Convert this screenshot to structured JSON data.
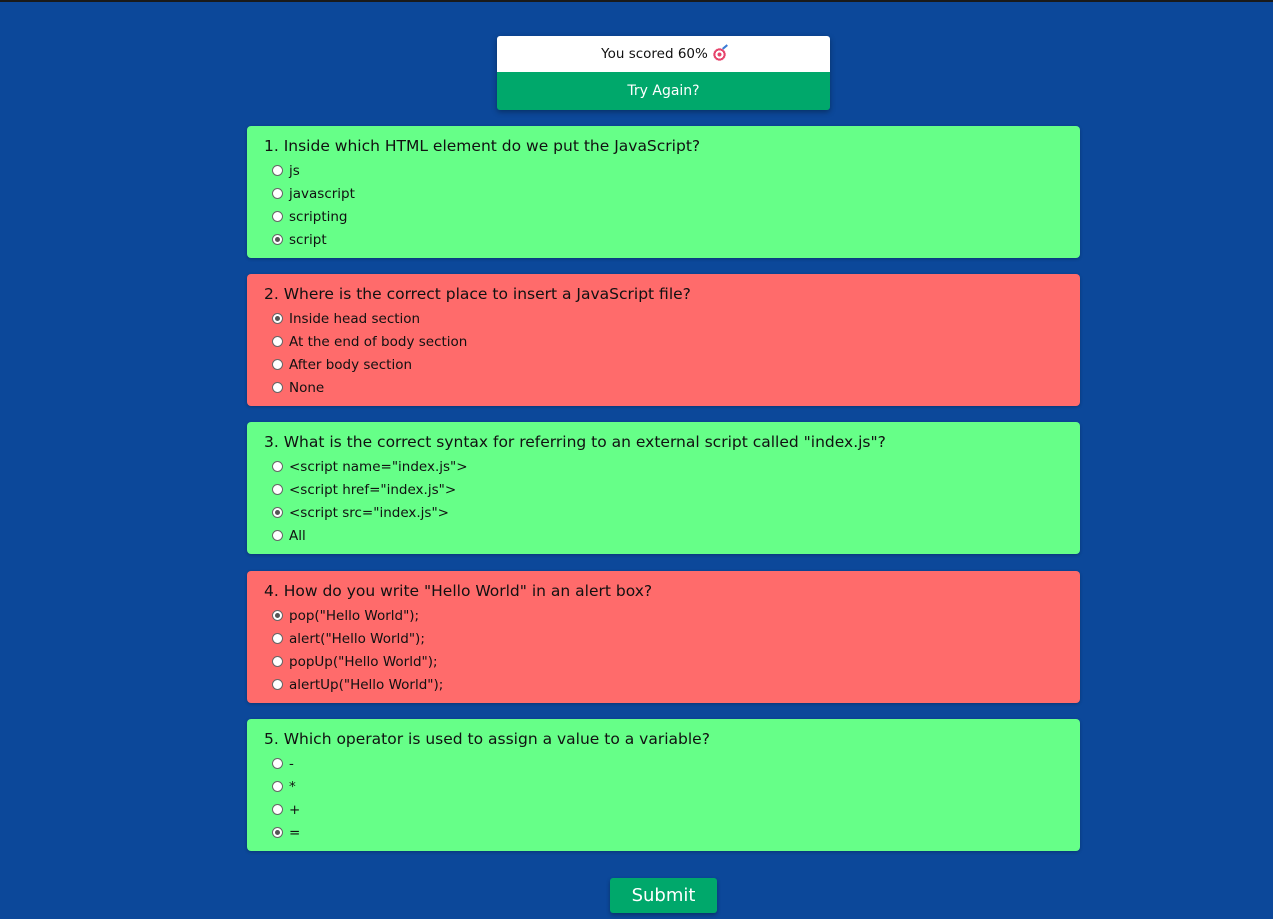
{
  "score": {
    "text": "You scored 60%",
    "icon": "target-icon",
    "try_again_label": "Try Again?"
  },
  "questions": [
    {
      "title": "1. Inside which HTML element do we put the JavaScript?",
      "status": "correct",
      "options": [
        "js",
        "javascript",
        "scripting",
        "script"
      ],
      "selected_index": 3
    },
    {
      "title": "2. Where is the correct place to insert a JavaScript file?",
      "status": "wrong",
      "options": [
        "Inside head section",
        "At the end of body section",
        "After body section",
        "None"
      ],
      "selected_index": 0
    },
    {
      "title": "3. What is the correct syntax for referring to an external script called \"index.js\"?",
      "status": "correct",
      "options": [
        "<script name=\"index.js\">",
        "<script href=\"index.js\">",
        "<script src=\"index.js\">",
        "All"
      ],
      "selected_index": 2
    },
    {
      "title": "4. How do you write \"Hello World\" in an alert box?",
      "status": "wrong",
      "options": [
        "pop(\"Hello World\");",
        "alert(\"Hello World\");",
        "popUp(\"Hello World\");",
        "alertUp(\"Hello World\");"
      ],
      "selected_index": 0
    },
    {
      "title": "5. Which operator is used to assign a value to a variable?",
      "status": "correct",
      "options": [
        "-",
        "*",
        "+",
        "="
      ],
      "selected_index": 3
    }
  ],
  "submit_label": "Submit",
  "colors": {
    "background": "#0c489a",
    "correct": "#66ff88",
    "wrong": "#ff6b6b",
    "accent": "#00a86b"
  }
}
